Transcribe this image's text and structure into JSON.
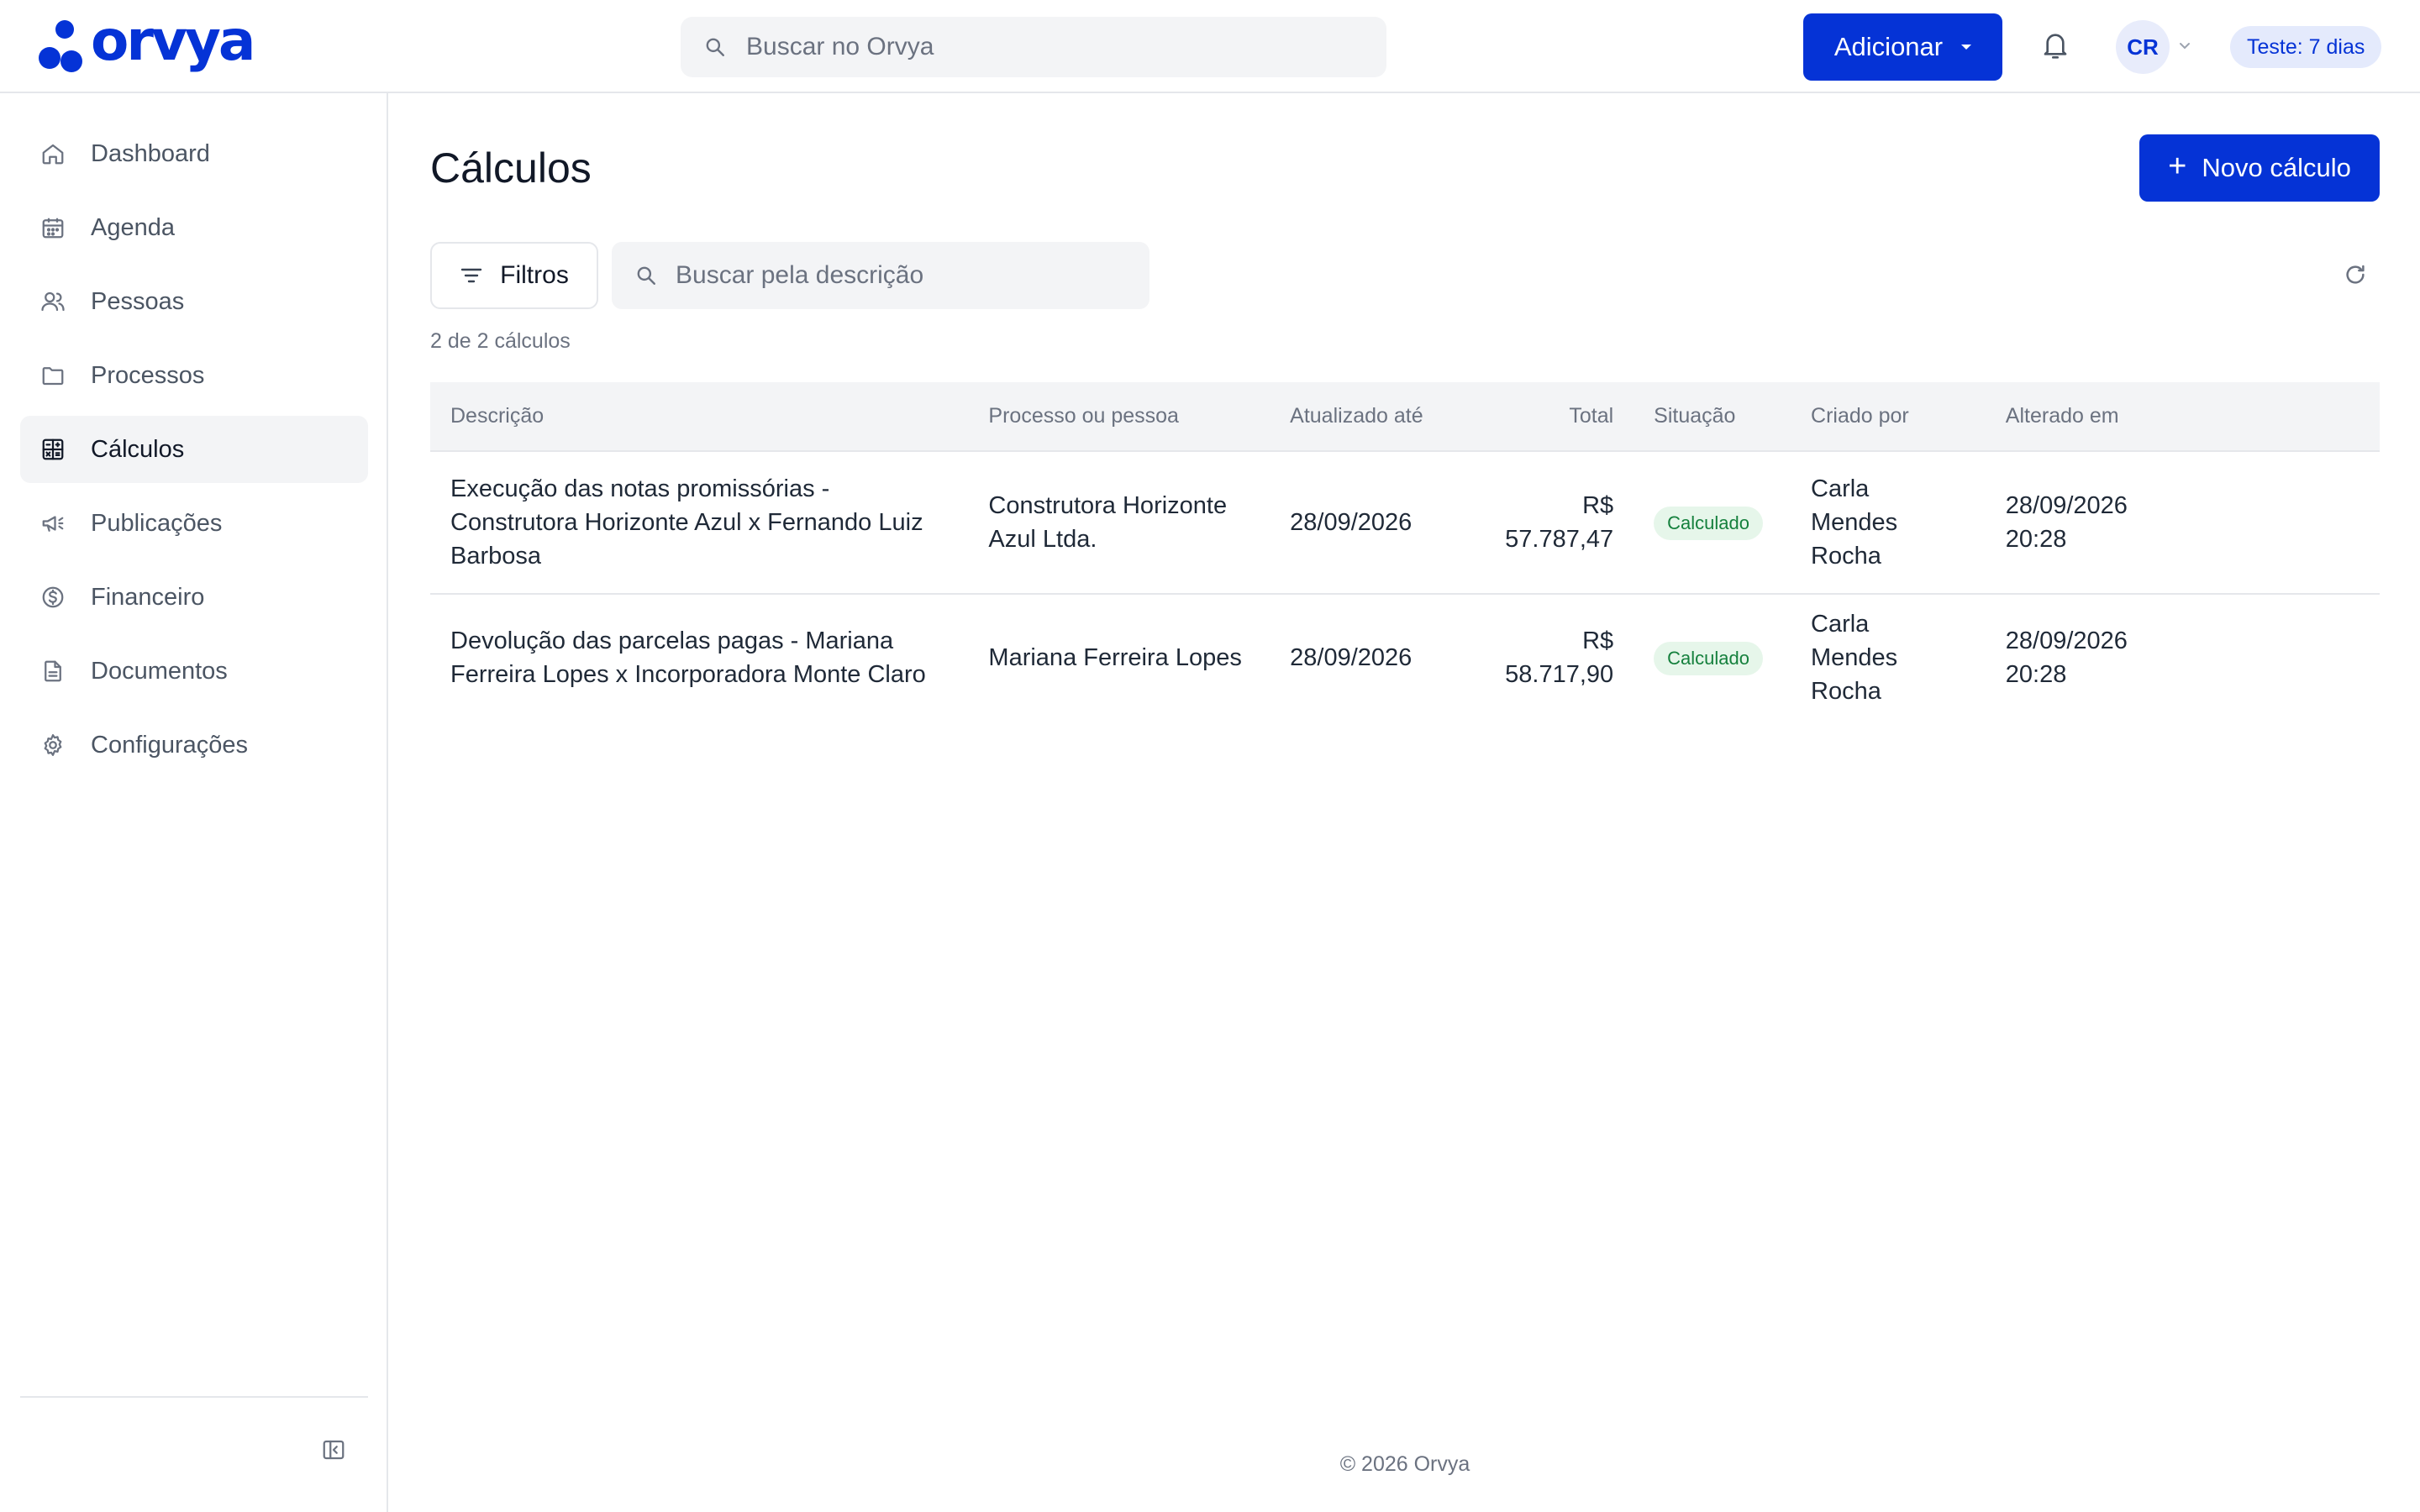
{
  "brand": {
    "name": "orvya",
    "color": "#0533d6"
  },
  "header": {
    "search_placeholder": "Buscar no Orvya",
    "add_label": "Adicionar",
    "avatar_initials": "CR",
    "trial_label": "Teste: 7 dias"
  },
  "sidebar": {
    "items": [
      {
        "label": "Dashboard",
        "icon": "home-icon"
      },
      {
        "label": "Agenda",
        "icon": "calendar-icon"
      },
      {
        "label": "Pessoas",
        "icon": "users-icon"
      },
      {
        "label": "Processos",
        "icon": "folder-icon"
      },
      {
        "label": "Cálculos",
        "icon": "calculator-icon",
        "active": true
      },
      {
        "label": "Publicações",
        "icon": "megaphone-icon"
      },
      {
        "label": "Financeiro",
        "icon": "dollar-circle-icon"
      },
      {
        "label": "Documentos",
        "icon": "document-icon"
      },
      {
        "label": "Configurações",
        "icon": "gear-icon"
      }
    ]
  },
  "page": {
    "title": "Cálculos",
    "new_button_label": "Novo cálculo",
    "filters_label": "Filtros",
    "search_placeholder": "Buscar pela descrição",
    "count_text": "2 de 2 cálculos"
  },
  "table": {
    "columns": {
      "description": "Descrição",
      "party": "Processo ou pessoa",
      "updated_until": "Atualizado até",
      "total": "Total",
      "status": "Situação",
      "created_by": "Criado por",
      "modified_at": "Alterado em"
    },
    "rows": [
      {
        "description": "Execução das notas promissórias - Construtora Horizonte Azul x Fernando Luiz Barbosa",
        "party": "Construtora Horizonte Azul Ltda.",
        "updated_until": "28/09/2026",
        "total": "R$ 57.787,47",
        "status": "Calculado",
        "created_by": "Carla Mendes Rocha",
        "modified_at": "28/09/2026 20:28"
      },
      {
        "description": "Devolução das parcelas pagas - Mariana Ferreira Lopes x Incorporadora Monte Claro",
        "party": "Mariana Ferreira Lopes",
        "updated_until": "28/09/2026",
        "total": "R$ 58.717,90",
        "status": "Calculado",
        "created_by": "Carla Mendes Rocha",
        "modified_at": "28/09/2026 20:28"
      }
    ]
  },
  "footer": {
    "text": "© 2026 Orvya"
  }
}
